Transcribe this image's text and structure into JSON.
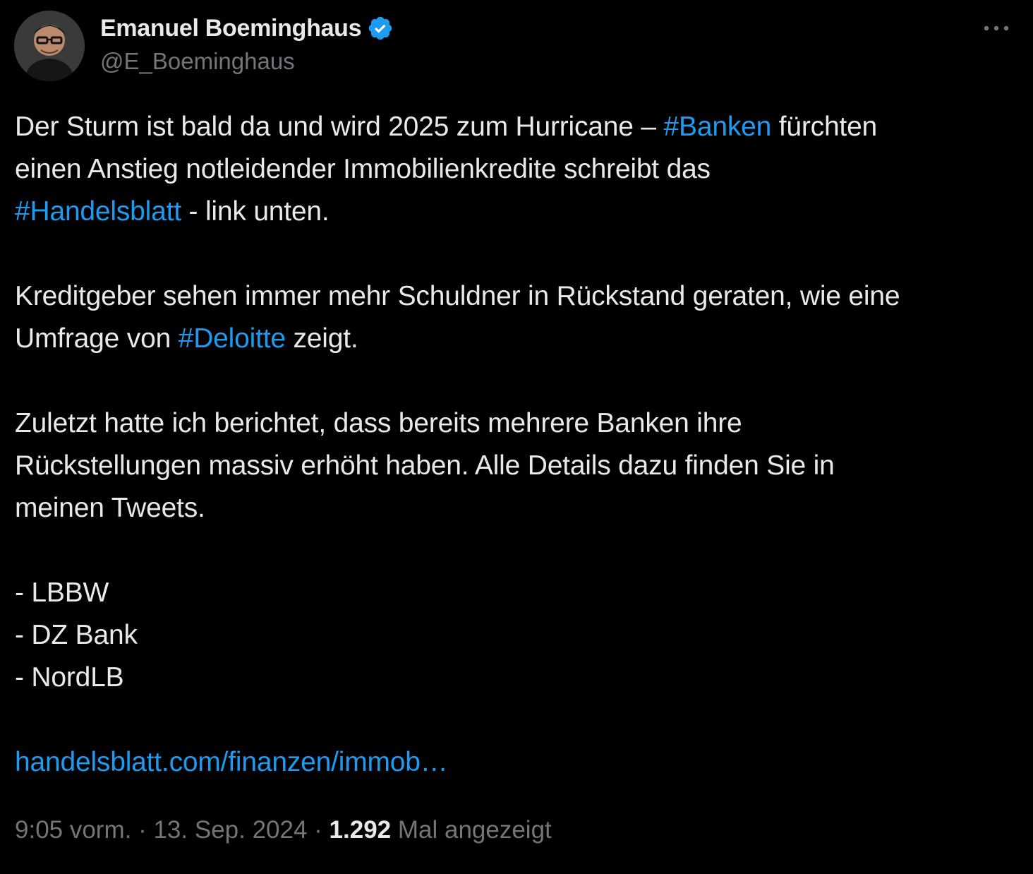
{
  "author": {
    "display_name": "Emanuel Boeminghaus",
    "handle": "@E_Boeminghaus",
    "verified": true
  },
  "tweet": {
    "lines": [
      [
        {
          "t": "Der Sturm ist bald da und wird 2025 zum Hurricane – "
        },
        {
          "t": "#Banken",
          "tag": true
        },
        {
          "t": " fürchten"
        }
      ],
      [
        {
          "t": "einen Anstieg notleidender Immobilienkredite schreibt das"
        }
      ],
      [
        {
          "t": "#Handelsblatt",
          "tag": true
        },
        {
          "t": " - link unten."
        }
      ],
      [],
      [
        {
          "t": "Kreditgeber sehen immer mehr Schuldner in Rückstand geraten, wie eine"
        }
      ],
      [
        {
          "t": "Umfrage von "
        },
        {
          "t": "#Deloitte",
          "tag": true
        },
        {
          "t": " zeigt."
        }
      ],
      [],
      [
        {
          "t": "Zuletzt hatte ich berichtet, dass bereits mehrere Banken ihre"
        }
      ],
      [
        {
          "t": "Rückstellungen massiv erhöht haben. Alle Details dazu finden Sie in"
        }
      ],
      [
        {
          "t": "meinen Tweets."
        }
      ],
      [],
      [
        {
          "t": "- LBBW"
        }
      ],
      [
        {
          "t": "- DZ Bank"
        }
      ],
      [
        {
          "t": "- NordLB"
        }
      ],
      [],
      [
        {
          "t": "handelsblatt.com/finanzen/immob…",
          "link": true
        }
      ]
    ],
    "time": "9:05 vorm.",
    "separator": " · ",
    "date": "13. Sep. 2024",
    "views_count": "1.292",
    "views_label": " Mal angezeigt"
  },
  "icons": {
    "verified": "verified-badge-icon",
    "more": "more-options-icon"
  },
  "colors": {
    "background": "#000000",
    "text": "#e7e9ea",
    "secondary": "#71767b",
    "accent": "#1d9bf0"
  }
}
